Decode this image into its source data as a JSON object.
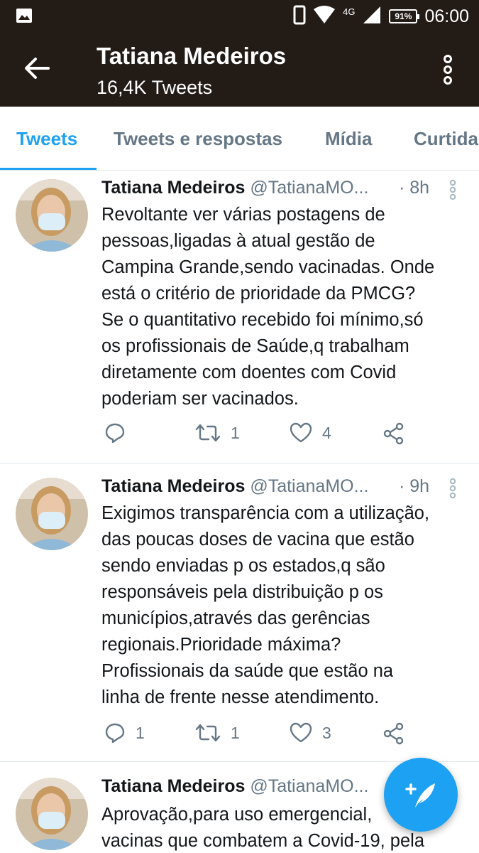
{
  "statusbar": {
    "time": "06:00",
    "battery": "91%",
    "network": "4G",
    "icons": [
      "image-icon",
      "phone-icon",
      "wifi-icon",
      "signal-icon",
      "battery-icon"
    ]
  },
  "header": {
    "title": "Tatiana Medeiros",
    "subtitle": "16,4K Tweets"
  },
  "tabs": [
    {
      "label": "Tweets",
      "active": true
    },
    {
      "label": "Tweets e respostas",
      "active": false
    },
    {
      "label": "Mídia",
      "active": false
    },
    {
      "label": "Curtidas",
      "active": false
    }
  ],
  "tweets": [
    {
      "name": "Tatiana Medeiros",
      "handle": "@TatianaMO...",
      "time": "· 8h",
      "lines": [
        "Revoltante ver várias postagens de",
        "pessoas,ligadas à atual gestão de",
        "Campina Grande,sendo vacinadas. Onde",
        "está o critério de prioridade da PMCG?",
        "Se o quantitativo recebido foi mínimo,só",
        "os profissionais de Saúde,q trabalham",
        "diretamente com doentes com Covid",
        "poderiam ser vacinados."
      ],
      "replies": "",
      "retweets": "1",
      "likes": "4"
    },
    {
      "name": "Tatiana Medeiros",
      "handle": "@TatianaMO...",
      "time": "· 9h",
      "lines": [
        "Exigimos transparência com a utilização,",
        "das poucas doses de vacina que estão",
        "sendo enviadas p os estados,q são",
        "responsáveis pela distribuição p os",
        "municípios,através das gerências",
        "regionais.Prioridade máxima?",
        "Profissionais da saúde que estão na",
        "linha de frente nesse atendimento."
      ],
      "replies": "1",
      "retweets": "1",
      "likes": "3"
    },
    {
      "name": "Tatiana Medeiros",
      "handle": "@TatianaMO...",
      "time": "",
      "lines": [
        "Aprovação,para uso emergencial,",
        "vacinas que combatem a Covid-19, pela"
      ]
    }
  ],
  "colors": {
    "header_bg": "#231b16",
    "accent": "#1da1f2",
    "secondary_text": "#657786"
  }
}
